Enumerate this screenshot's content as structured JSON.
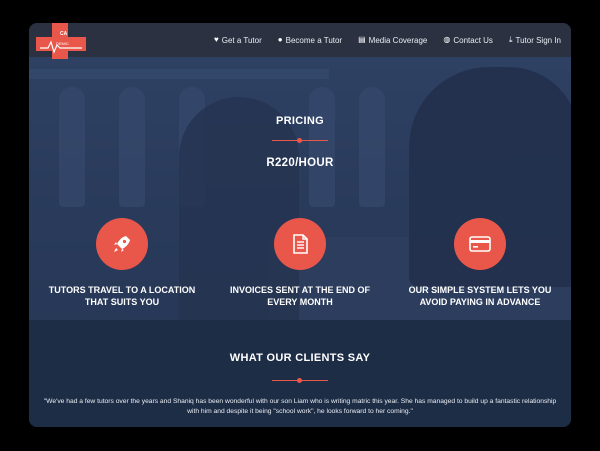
{
  "brand": {
    "logo_text": "ACADEMIC AMBITIC",
    "logo_color": "#e8574a"
  },
  "nav": [
    {
      "label": "Get a Tutor",
      "icon": "heart-icon",
      "glyph": "♥"
    },
    {
      "label": "Become a Tutor",
      "icon": "user-icon",
      "glyph": "●"
    },
    {
      "label": "Media Coverage",
      "icon": "newspaper-icon",
      "glyph": "▤"
    },
    {
      "label": "Contact Us",
      "icon": "chat-icon",
      "glyph": "◍"
    },
    {
      "label": "Tutor Sign In",
      "icon": "download-icon",
      "glyph": "⤓"
    }
  ],
  "pricing": {
    "title": "PRICING",
    "price": "R220/HOUR"
  },
  "features": [
    {
      "icon": "rocket-icon",
      "text": "TUTORS TRAVEL TO A LOCATION THAT SUITS YOU"
    },
    {
      "icon": "document-icon",
      "text": "INVOICES SENT AT THE END OF EVERY MONTH"
    },
    {
      "icon": "credit-card-icon",
      "text": "OUR SIMPLE SYSTEM LETS YOU AVOID PAYING IN ADVANCE"
    }
  ],
  "testimonials": {
    "title": "WHAT OUR CLIENTS SAY",
    "quote": "\"We've had a few tutors over the years and Shaniq has been wonderful with our son Liam who is writing matric this year.  She has managed to build up a fantastic relationship with him and despite it being \"school work\", he looks forward to her coming.\""
  },
  "colors": {
    "accent": "#e8574a",
    "navbar": "#2b3140",
    "footer_bg": "#1e2d46"
  }
}
